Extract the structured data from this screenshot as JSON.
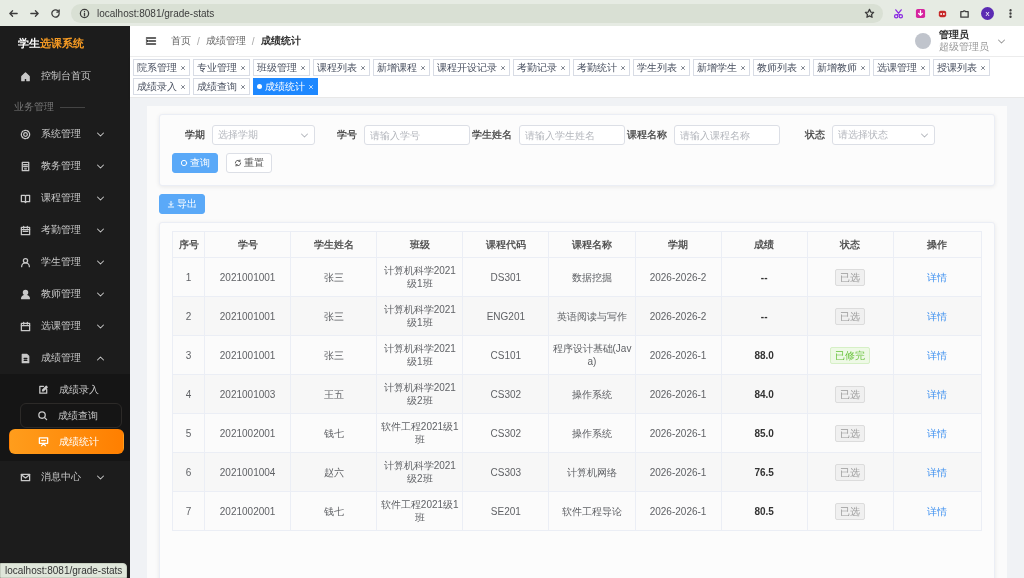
{
  "browser": {
    "url": "localhost:8081/grade-stats",
    "profile_initial": "x"
  },
  "sidebar": {
    "logo": [
      {
        "text": "学生",
        "accent": false
      },
      {
        "text": "选课系统",
        "accent": true
      }
    ],
    "items": [
      {
        "kind": "link",
        "label": "控制台首页"
      },
      {
        "kind": "heading",
        "label": "业务管理"
      },
      {
        "kind": "group",
        "label": "系统管理",
        "expanded": false
      },
      {
        "kind": "group",
        "label": "教务管理",
        "expanded": false
      },
      {
        "kind": "group",
        "label": "课程管理",
        "expanded": false
      },
      {
        "kind": "group",
        "label": "考勤管理",
        "expanded": false
      },
      {
        "kind": "group",
        "label": "学生管理",
        "expanded": false
      },
      {
        "kind": "group",
        "label": "教师管理",
        "expanded": false
      },
      {
        "kind": "group",
        "label": "选课管理",
        "expanded": false
      },
      {
        "kind": "group",
        "label": "成绩管理",
        "expanded": true,
        "children": [
          {
            "label": "成绩录入",
            "selected": false,
            "hovered": false
          },
          {
            "label": "成绩查询",
            "selected": false,
            "hovered": true
          },
          {
            "label": "成绩统计",
            "selected": true,
            "hovered": false
          }
        ]
      },
      {
        "kind": "group",
        "label": "消息中心",
        "expanded": false
      }
    ]
  },
  "header": {
    "breadcrumb": [
      "首页",
      "成绩管理",
      "成绩统计"
    ],
    "breadcrumb_separator": "/",
    "user": {
      "name": "管理员",
      "role": "超级管理员"
    }
  },
  "tabs": [
    {
      "label": "院系管理",
      "selected": false
    },
    {
      "label": "专业管理",
      "selected": false
    },
    {
      "label": "班级管理",
      "selected": false
    },
    {
      "label": "课程列表",
      "selected": false
    },
    {
      "label": "新增课程",
      "selected": false
    },
    {
      "label": "课程开设记录",
      "selected": false
    },
    {
      "label": "考勤记录",
      "selected": false
    },
    {
      "label": "考勤统计",
      "selected": false
    },
    {
      "label": "学生列表",
      "selected": false
    },
    {
      "label": "新增学生",
      "selected": false
    },
    {
      "label": "教师列表",
      "selected": false
    },
    {
      "label": "新增教师",
      "selected": false
    },
    {
      "label": "选课管理",
      "selected": false
    },
    {
      "label": "授课列表",
      "selected": false
    },
    {
      "label": "成绩录入",
      "selected": false
    },
    {
      "label": "成绩查询",
      "selected": false
    },
    {
      "label": "成绩统计",
      "selected": true
    }
  ],
  "filter": {
    "fields": [
      {
        "kind": "select",
        "label": "学期",
        "placeholder": "选择学期"
      },
      {
        "kind": "input",
        "label": "学号",
        "placeholder": "请输入学号"
      },
      {
        "kind": "input",
        "label": "学生姓名",
        "placeholder": "请输入学生姓名"
      },
      {
        "kind": "input",
        "label": "课程名称",
        "placeholder": "请输入课程名称"
      },
      {
        "kind": "select",
        "label": "状态",
        "placeholder": "请选择状态"
      }
    ],
    "buttons": [
      {
        "kind": "primary",
        "label": "查询"
      },
      {
        "kind": "default",
        "label": "重置"
      }
    ]
  },
  "export_button": "导出",
  "table": {
    "columns": [
      "序号",
      "学号",
      "学生姓名",
      "班级",
      "课程代码",
      "课程名称",
      "学期",
      "成绩",
      "状态",
      "操作"
    ],
    "rows": [
      {
        "no": "1",
        "student_id": "2021001001",
        "name": "张三",
        "class": "计算机科学2021级1班",
        "course_code": "DS301",
        "course_name": "数据挖掘",
        "term": "2026-2026-2",
        "grade": "--",
        "status": {
          "text": "已选",
          "kind": "selected"
        },
        "action": "详情"
      },
      {
        "no": "2",
        "student_id": "2021001001",
        "name": "张三",
        "class": "计算机科学2021级1班",
        "course_code": "ENG201",
        "course_name": "英语阅读与写作",
        "term": "2026-2026-2",
        "grade": "--",
        "status": {
          "text": "已选",
          "kind": "selected"
        },
        "action": "详情"
      },
      {
        "no": "3",
        "student_id": "2021001001",
        "name": "张三",
        "class": "计算机科学2021级1班",
        "course_code": "CS101",
        "course_name": "程序设计基础(Java)",
        "term": "2026-2026-1",
        "grade": "88.0",
        "status": {
          "text": "已修完",
          "kind": "completed"
        },
        "action": "详情"
      },
      {
        "no": "4",
        "student_id": "2021001003",
        "name": "王五",
        "class": "计算机科学2021级2班",
        "course_code": "CS302",
        "course_name": "操作系统",
        "term": "2026-2026-1",
        "grade": "84.0",
        "status": {
          "text": "已选",
          "kind": "selected"
        },
        "action": "详情"
      },
      {
        "no": "5",
        "student_id": "2021002001",
        "name": "钱七",
        "class": "软件工程2021级1班",
        "course_code": "CS302",
        "course_name": "操作系统",
        "term": "2026-2026-1",
        "grade": "85.0",
        "status": {
          "text": "已选",
          "kind": "selected"
        },
        "action": "详情"
      },
      {
        "no": "6",
        "student_id": "2021001004",
        "name": "赵六",
        "class": "计算机科学2021级2班",
        "course_code": "CS303",
        "course_name": "计算机网络",
        "term": "2026-2026-1",
        "grade": "76.5",
        "status": {
          "text": "已选",
          "kind": "selected"
        },
        "action": "详情"
      },
      {
        "no": "7",
        "student_id": "2021002001",
        "name": "钱七",
        "class": "软件工程2021级1班",
        "course_code": "SE201",
        "course_name": "软件工程导论",
        "term": "2026-2026-1",
        "grade": "80.5",
        "status": {
          "text": "已选",
          "kind": "selected"
        },
        "action": "详情"
      }
    ]
  },
  "status_bar": "localhost:8081/grade-stats"
}
